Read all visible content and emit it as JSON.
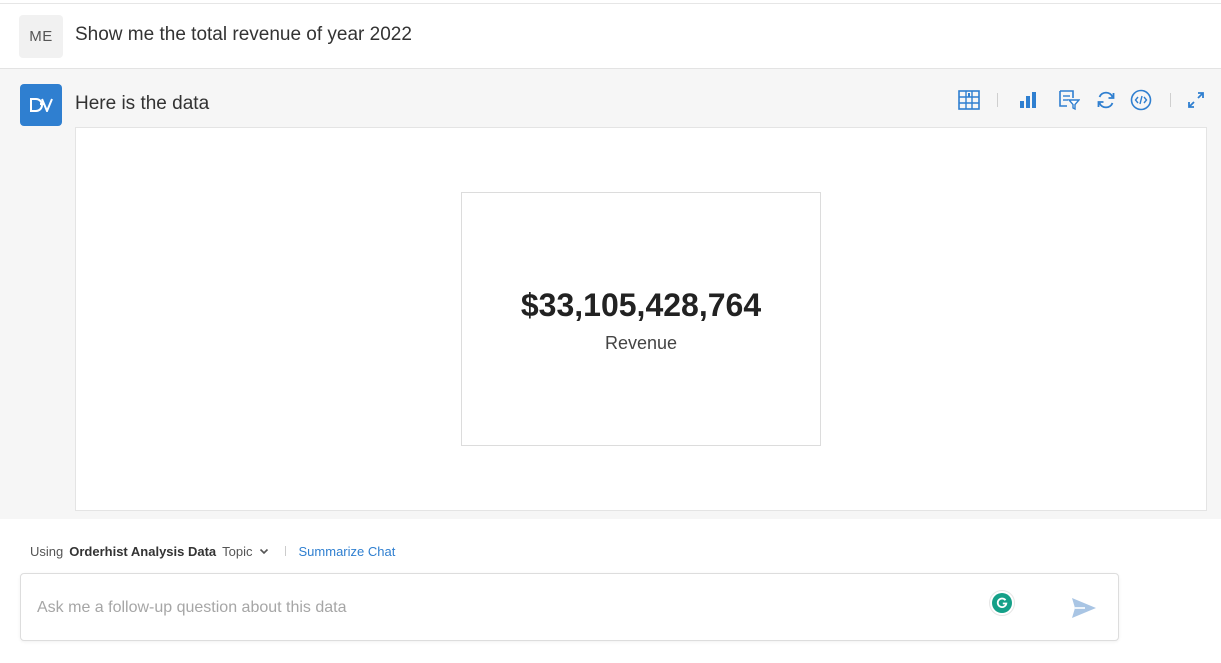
{
  "user": {
    "avatar_initials": "ME",
    "message": "Show me the total revenue of year 2022"
  },
  "assistant": {
    "avatar_label": "DV",
    "message": "Here is the data",
    "toolbar_icons": [
      "table-icon",
      "bar-chart-icon",
      "filter-edit-icon",
      "refresh-icon",
      "code-icon",
      "expand-icon"
    ],
    "kpi": {
      "value": "$33,105,428,764",
      "label": "Revenue"
    }
  },
  "footer": {
    "using_prefix": "Using",
    "topic_name": "Orderhist Analysis Data",
    "topic_suffix": "Topic",
    "summarize_label": "Summarize Chat",
    "input_placeholder": "Ask me a follow-up question about this data"
  },
  "colors": {
    "accent": "#2f7fd0",
    "grammarly": "#15a088",
    "send_icon": "#a9c5e4"
  }
}
